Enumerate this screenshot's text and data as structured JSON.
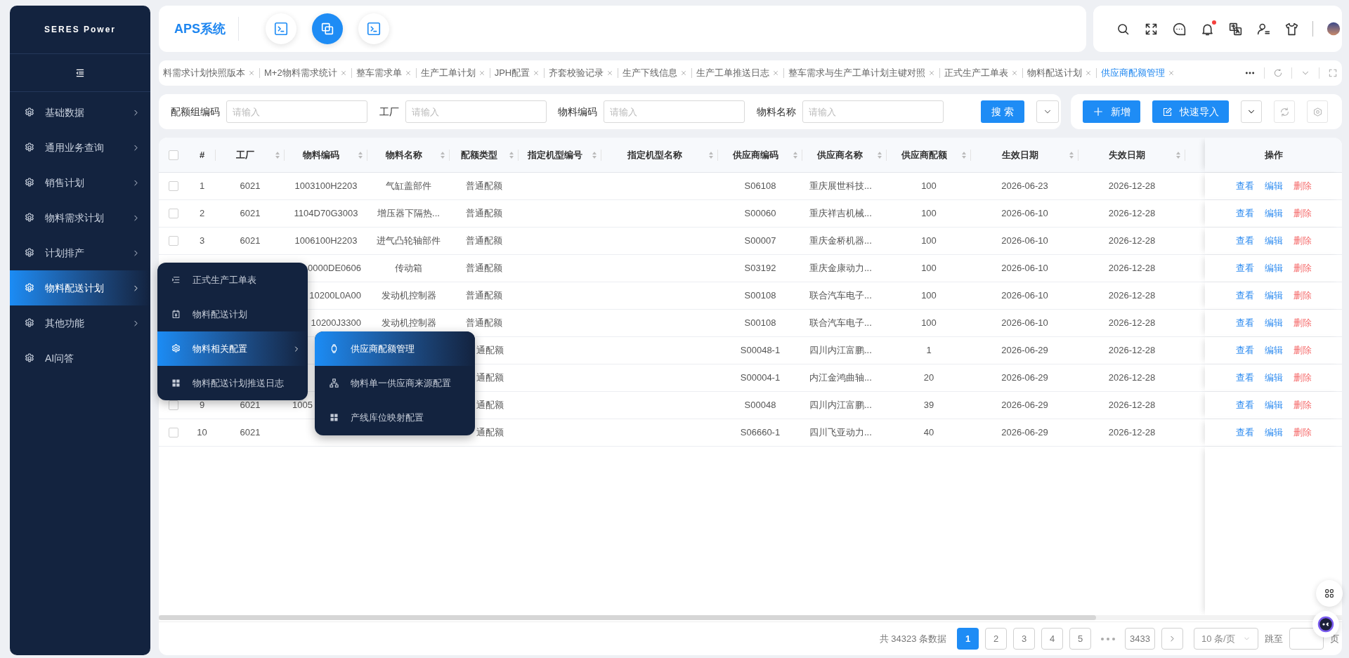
{
  "sidebar": {
    "logo": "SERES Power",
    "items": [
      {
        "label": "基础数据",
        "selected": false,
        "expandable": true
      },
      {
        "label": "通用业务查询",
        "selected": false,
        "expandable": true
      },
      {
        "label": "销售计划",
        "selected": false,
        "expandable": true
      },
      {
        "label": "物料需求计划",
        "selected": false,
        "expandable": true
      },
      {
        "label": "计划排产",
        "selected": false,
        "expandable": true
      },
      {
        "label": "物料配送计划",
        "selected": true,
        "expandable": true
      },
      {
        "label": "其他功能",
        "selected": false,
        "expandable": true
      },
      {
        "label": "AI问答",
        "selected": false,
        "expandable": false
      }
    ]
  },
  "header": {
    "title": "APS系统",
    "apps": [
      {
        "selected": false
      },
      {
        "selected": true
      },
      {
        "selected": false
      }
    ],
    "notification_dot": true
  },
  "tabs": [
    {
      "label": "料需求计划快照版本",
      "selected": false
    },
    {
      "label": "M+2物料需求统计",
      "selected": false
    },
    {
      "label": "整车需求单",
      "selected": false
    },
    {
      "label": "生产工单计划",
      "selected": false
    },
    {
      "label": "JPH配置",
      "selected": false
    },
    {
      "label": "齐套校验记录",
      "selected": false
    },
    {
      "label": "生产下线信息",
      "selected": false
    },
    {
      "label": "生产工单推送日志",
      "selected": false
    },
    {
      "label": "整车需求与生产工单计划主键对照",
      "selected": false
    },
    {
      "label": "正式生产工单表",
      "selected": false
    },
    {
      "label": "物料配送计划",
      "selected": false
    },
    {
      "label": "供应商配额管理",
      "selected": true
    }
  ],
  "filters": [
    {
      "label": "配额组编码",
      "placeholder": "请输入"
    },
    {
      "label": "工厂",
      "placeholder": "请输入"
    },
    {
      "label": "物料编码",
      "placeholder": "请输入"
    },
    {
      "label": "物料名称",
      "placeholder": "请输入"
    }
  ],
  "search_button": "搜 索",
  "add_button": "新增",
  "import_button": "快速导入",
  "table": {
    "header_checked": false,
    "actions_column": "操作",
    "columns": [
      {
        "label": "#",
        "sortable": false
      },
      {
        "label": "工厂",
        "sortable": true
      },
      {
        "label": "物料编码",
        "sortable": true
      },
      {
        "label": "物料名称",
        "sortable": true
      },
      {
        "label": "配额类型",
        "sortable": true
      },
      {
        "label": "指定机型编号",
        "sortable": true
      },
      {
        "label": "指定机型名称",
        "sortable": true
      },
      {
        "label": "供应商编码",
        "sortable": true
      },
      {
        "label": "供应商名称",
        "sortable": true
      },
      {
        "label": "供应商配额",
        "sortable": true
      },
      {
        "label": "生效日期",
        "sortable": true
      },
      {
        "label": "失效日期",
        "sortable": true
      }
    ],
    "rows": [
      {
        "checked": false,
        "cells": [
          "1",
          "6021",
          "1003100H2203",
          "气缸盖部件",
          "普通配额",
          null,
          null,
          "S06108",
          "重庆展世科技...",
          "100",
          "2026-06-23",
          "2026-12-28"
        ],
        "actions": [
          {
            "label": "查看",
            "kind": "link"
          },
          {
            "label": "编辑",
            "kind": "link"
          },
          {
            "label": "删除",
            "kind": "danger"
          }
        ]
      },
      {
        "checked": false,
        "cells": [
          "2",
          "6021",
          "1104D70G3003",
          "增压器下隔热...",
          "普通配额",
          null,
          null,
          "S00060",
          "重庆祥吉机械...",
          "100",
          "2026-06-10",
          "2026-12-28"
        ],
        "actions": [
          {
            "label": "查看",
            "kind": "link"
          },
          {
            "label": "编辑",
            "kind": "link"
          },
          {
            "label": "删除",
            "kind": "danger"
          }
        ]
      },
      {
        "checked": false,
        "cells": [
          "3",
          "6021",
          "1006100H2203",
          "进气凸轮轴部件",
          "普通配额",
          null,
          null,
          "S00007",
          "重庆金桥机器...",
          "100",
          "2026-06-10",
          "2026-12-28"
        ],
        "actions": [
          {
            "label": "查看",
            "kind": "link"
          },
          {
            "label": "编辑",
            "kind": "link"
          },
          {
            "label": "删除",
            "kind": "danger"
          }
        ]
      },
      {
        "cells": [
          null,
          null,
          {
            "text": "0000DE0606",
            "cut_start": true
          },
          "传动箱",
          "普通配额",
          null,
          null,
          "S03192",
          "重庆金康动力...",
          "100",
          "2026-06-10",
          "2026-12-28"
        ],
        "actions": [
          {
            "label": "查看",
            "kind": "link"
          },
          {
            "label": "编辑",
            "kind": "link"
          },
          {
            "label": "删除",
            "kind": "danger"
          }
        ]
      },
      {
        "cells": [
          null,
          null,
          {
            "text": "10200L0A00",
            "cut_start": true
          },
          "发动机控制器",
          "普通配额",
          null,
          null,
          "S00108",
          "联合汽车电子...",
          "100",
          "2026-06-10",
          "2026-12-28"
        ],
        "actions": [
          {
            "label": "查看",
            "kind": "link"
          },
          {
            "label": "编辑",
            "kind": "link"
          },
          {
            "label": "删除",
            "kind": "danger"
          }
        ]
      },
      {
        "cells": [
          null,
          null,
          {
            "text": "10200J3300",
            "cut_start": true
          },
          "发动机控制器",
          "普通配额",
          null,
          null,
          "S00108",
          "联合汽车电子...",
          "100",
          "2026-06-10",
          "2026-12-28"
        ],
        "actions": [
          {
            "label": "查看",
            "kind": "link"
          },
          {
            "label": "编辑",
            "kind": "link"
          },
          {
            "label": "删除",
            "kind": "danger"
          }
        ]
      },
      {
        "cells": [
          null,
          null,
          null,
          null,
          {
            "text": "通配额",
            "cut_start": true
          },
          null,
          null,
          "S00048-1",
          "四川内江富鹏...",
          "1",
          "2026-06-29",
          "2026-12-28"
        ],
        "actions": [
          {
            "label": "查看",
            "kind": "link"
          },
          {
            "label": "编辑",
            "kind": "link"
          },
          {
            "label": "删除",
            "kind": "danger"
          }
        ]
      },
      {
        "cells": [
          null,
          null,
          null,
          null,
          {
            "text": "通配额",
            "cut_start": true
          },
          null,
          null,
          "S00004-1",
          "内江金鸿曲轴...",
          "20",
          "2026-06-29",
          "2026-12-28"
        ],
        "actions": [
          {
            "label": "查看",
            "kind": "link"
          },
          {
            "label": "编辑",
            "kind": "link"
          },
          {
            "label": "删除",
            "kind": "danger"
          }
        ]
      },
      {
        "checked": false,
        "cells": [
          "9",
          "6021",
          {
            "text": "1005",
            "cut_end": true
          },
          null,
          {
            "text": "通配额",
            "cut_start": true
          },
          null,
          null,
          "S00048",
          "四川内江富鹏...",
          "39",
          "2026-06-29",
          "2026-12-28"
        ],
        "actions": [
          {
            "label": "查看",
            "kind": "link"
          },
          {
            "label": "编辑",
            "kind": "link"
          },
          {
            "label": "删除",
            "kind": "danger"
          }
        ]
      },
      {
        "checked": false,
        "cells": [
          "10",
          "6021",
          null,
          null,
          {
            "text": "通配额",
            "cut_start": true
          },
          null,
          null,
          "S06660-1",
          "四川飞亚动力...",
          "40",
          "2026-06-29",
          "2026-12-28"
        ],
        "actions": [
          {
            "label": "查看",
            "kind": "link"
          },
          {
            "label": "编辑",
            "kind": "link"
          },
          {
            "label": "删除",
            "kind": "danger"
          }
        ]
      }
    ]
  },
  "pagination": {
    "total": "共 34323 条数据",
    "pages": [
      {
        "label": "1",
        "selected": true
      },
      {
        "label": "2",
        "selected": false
      },
      {
        "label": "3",
        "selected": false
      },
      {
        "label": "4",
        "selected": false
      },
      {
        "label": "5",
        "selected": false
      },
      {
        "label": "3433",
        "selected": false
      }
    ],
    "page_size": "10 条/页",
    "jump_label": "跳至",
    "page_unit": "页"
  },
  "menu_popup": {
    "items": [
      {
        "label": "正式生产工单表",
        "selected": false,
        "expandable": false
      },
      {
        "label": "物料配送计划",
        "selected": false,
        "expandable": false
      },
      {
        "label": "物料相关配置",
        "selected": true,
        "expandable": true
      },
      {
        "label": "物料配送计划推送日志",
        "selected": false,
        "expandable": false
      }
    ]
  },
  "submenu_popup": {
    "items": [
      {
        "label": "供应商配额管理",
        "selected": true
      },
      {
        "label": "物料单一供应商来源配置",
        "selected": false
      },
      {
        "label": "产线库位映射配置",
        "selected": false
      }
    ]
  }
}
